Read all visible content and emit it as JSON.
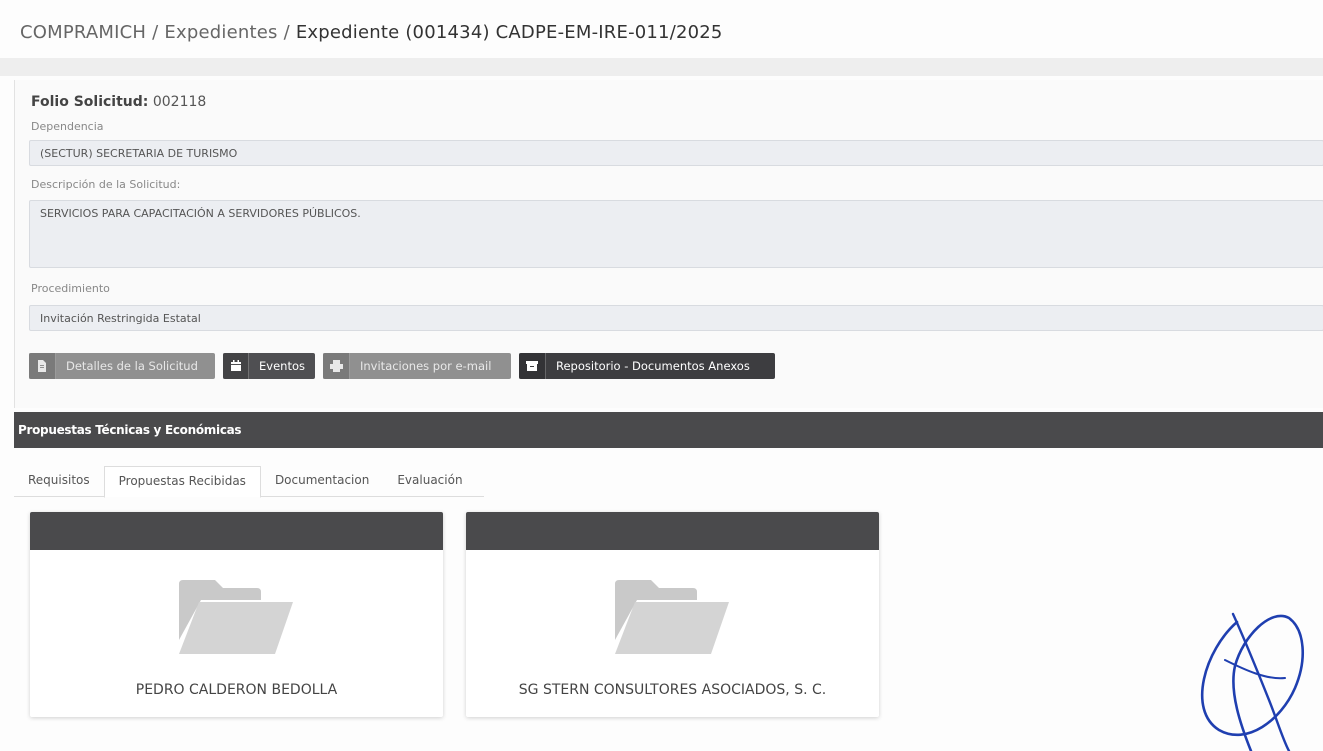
{
  "breadcrumb": {
    "root": "COMPRAMICH",
    "section": "Expedientes",
    "current": "Expediente (001434) CADPE-EM-IRE-011/2025",
    "separator": "/"
  },
  "solicitud": {
    "folio_label": "Folio Solicitud:",
    "folio_value": "002118",
    "dependencia_label": "Dependencia",
    "dependencia_value": "(SECTUR)  SECRETARIA DE TURISMO",
    "descripcion_label": "Descripción de la Solicitud:",
    "descripcion_value": "SERVICIOS PARA CAPACITACIÓN A SERVIDORES PÚBLICOS.",
    "procedimiento_label": "Procedimiento",
    "procedimiento_value": "Invitación Restringida Estatal"
  },
  "actions": {
    "detalles": "Detalles de la Solicitud",
    "eventos": "Eventos",
    "invitaciones": "Invitaciones por e-mail",
    "repositorio": "Repositorio - Documentos Anexos"
  },
  "propuestas": {
    "title": "Propuestas Técnicas y Económicas",
    "tabs": [
      "Requisitos",
      "Propuestas Recibidas",
      "Documentacion",
      "Evaluación"
    ],
    "active_tab": "Propuestas Recibidas",
    "cards": [
      {
        "name": "PEDRO CALDERON BEDOLLA",
        "icon": "folder-icon"
      },
      {
        "name": "SG STERN CONSULTORES ASOCIADOS, S. C.",
        "icon": "folder-icon"
      }
    ]
  },
  "colors": {
    "header_dark": "#4a4a4c",
    "button_gray": "#909090",
    "signature_blue": "#1f3fb0"
  }
}
